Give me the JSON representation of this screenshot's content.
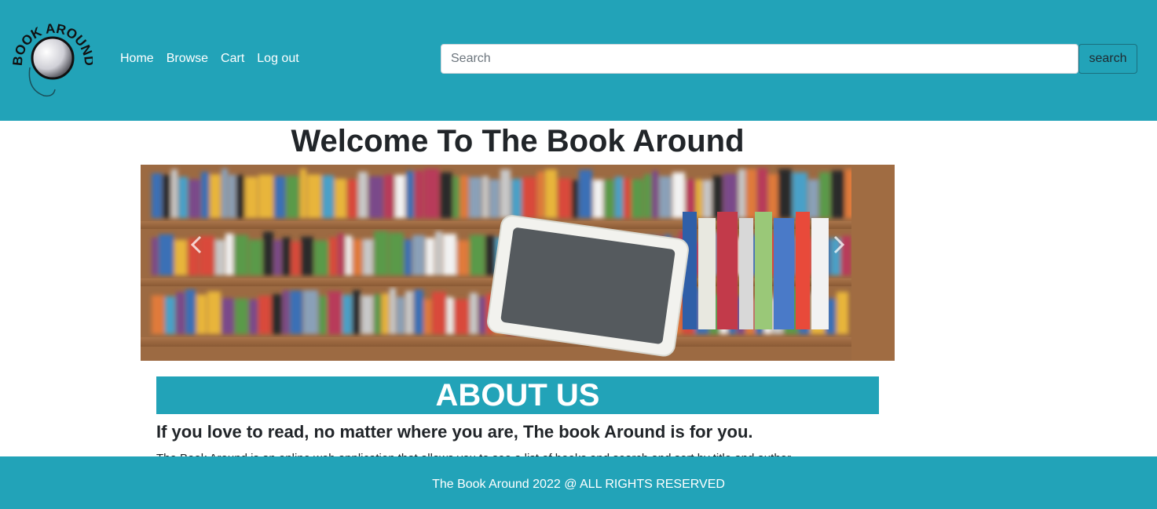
{
  "header": {
    "logo_text": "BOOK AROUND",
    "nav": [
      "Home",
      "Browse",
      "Cart",
      "Log out"
    ],
    "search_placeholder": "Search",
    "search_button": "search"
  },
  "main": {
    "title": "Welcome To The Book Around",
    "carousel": {
      "image": "bookshelf-with-tablet",
      "prev_icon": "chevron-left-icon",
      "next_icon": "chevron-right-icon"
    },
    "about": {
      "heading": "ABOUT US",
      "tagline": "If you love to read, no matter where you are, The book Around is for you.",
      "body": "The Book Around is an online web application that allows you to see a list of books and search and sort by title and author"
    }
  },
  "footer": {
    "text": "The Book Around 2022 @ ALL RIGHTS RESERVED"
  },
  "colors": {
    "brand": "#22a3b8",
    "text": "#212529",
    "white": "#ffffff"
  }
}
